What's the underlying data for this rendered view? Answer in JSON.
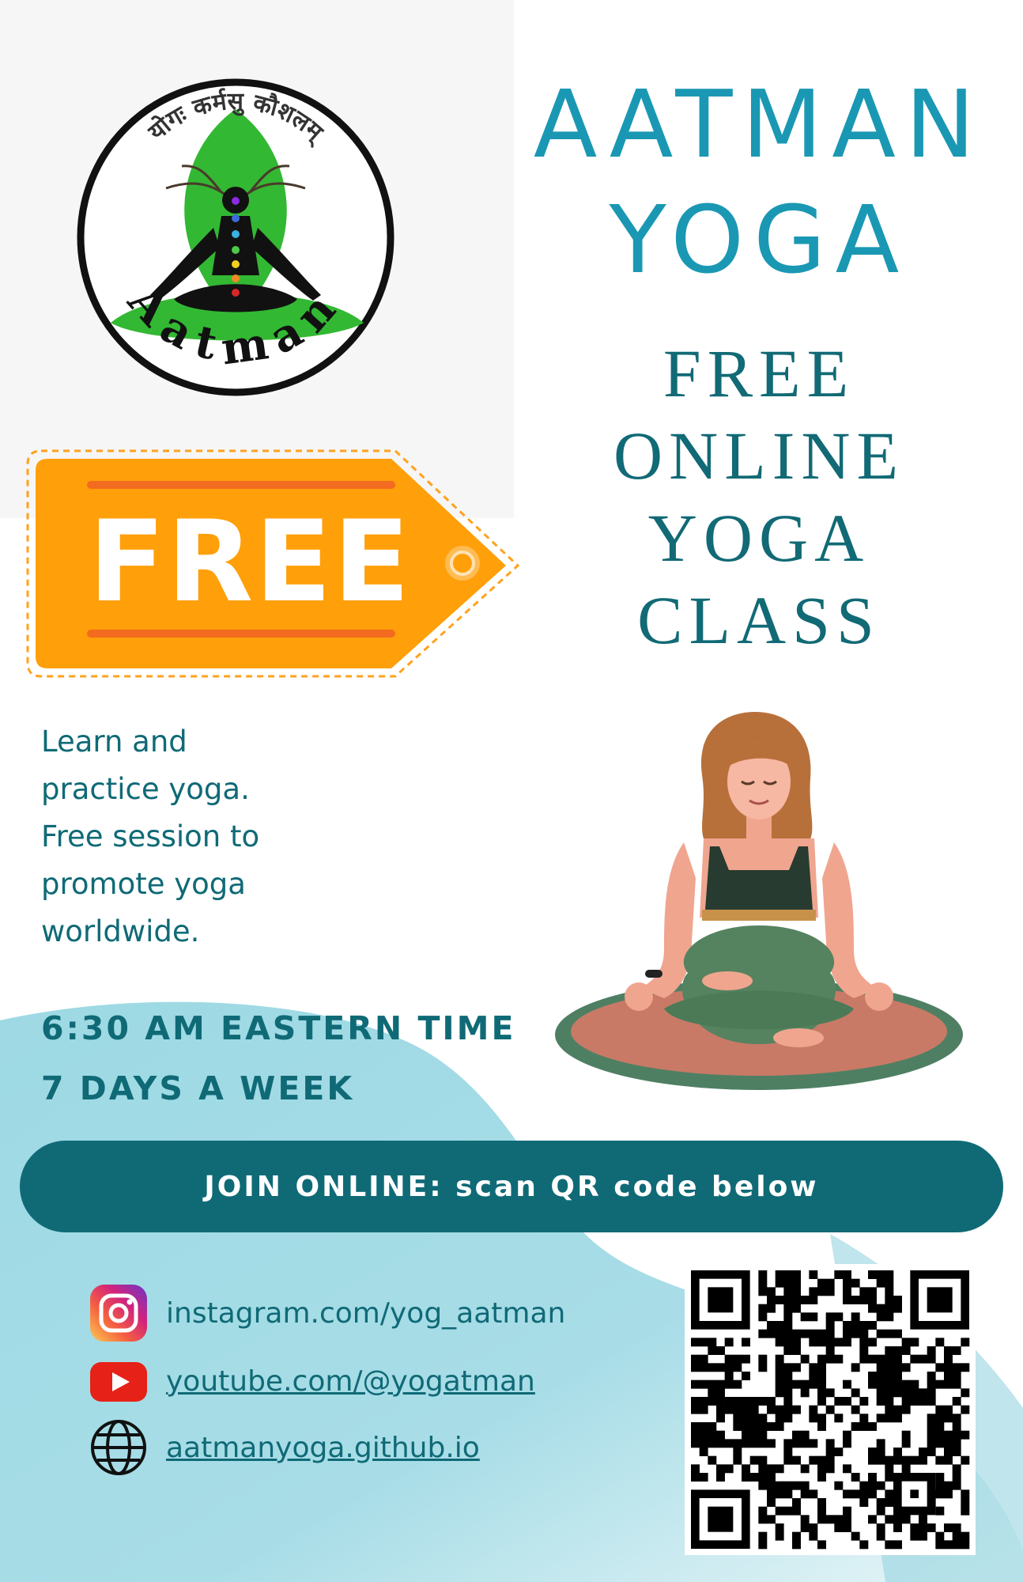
{
  "logo": {
    "arc_text": "योगः कर्मसु कौशलम्",
    "name": "Aatman",
    "icon": "meditating-figure-chakras-icon"
  },
  "tag": {
    "label": "FREE",
    "color": "#ff9f0a"
  },
  "brand": {
    "line1": "AATMAN",
    "line2": "YOGA",
    "color": "#1a98b3"
  },
  "headline": {
    "lines": [
      "FREE",
      "ONLINE",
      "YOGA",
      "CLASS"
    ],
    "color": "#116a75"
  },
  "description": {
    "lines": [
      "Learn and",
      "practice yoga.",
      "Free session to",
      "promote yoga",
      "worldwide."
    ]
  },
  "schedule": {
    "time": "6:30 AM EASTERN TIME",
    "days": "7 DAYS A WEEK"
  },
  "illustration": {
    "icon": "woman-meditating-icon"
  },
  "join": {
    "label": "JOIN ONLINE: scan QR code below",
    "color": "#0f6a76"
  },
  "social": {
    "instagram": {
      "text": "instagram.com/yog_aatman",
      "icon": "instagram-icon"
    },
    "youtube": {
      "text": "youtube.com/@yogatman",
      "icon": "youtube-icon"
    },
    "website": {
      "text": "aatmanyoga.github.io",
      "icon": "globe-icon"
    }
  },
  "qr": {
    "icon": "qr-code-icon"
  }
}
